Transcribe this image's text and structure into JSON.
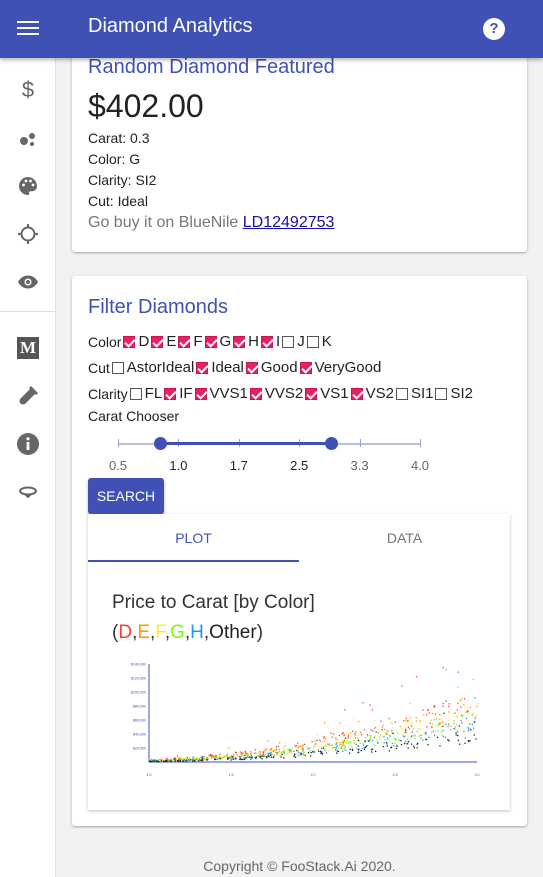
{
  "app": {
    "title": "Diamond Analytics"
  },
  "sidebar": {
    "items": [
      {
        "icon": "dollar-icon"
      },
      {
        "icon": "bubble-chart-icon"
      },
      {
        "icon": "palette-icon"
      },
      {
        "icon": "crosshair-icon"
      },
      {
        "icon": "eye-icon"
      },
      {
        "icon": "medium-icon",
        "glyph": "M"
      },
      {
        "icon": "test-tube-icon"
      },
      {
        "icon": "info-icon"
      },
      {
        "icon": "rotate-icon"
      }
    ]
  },
  "featured": {
    "title": "Random Diamond Featured",
    "price": "$402.00",
    "carat": "Carat: 0.3",
    "color": "Color: G",
    "clarity": "Clarity: SI2",
    "cut": "Cut: Ideal",
    "bluenile_text": "Go buy it on BlueNile",
    "bluenile_link": "LD12492753"
  },
  "filter": {
    "title": "Filter Diamonds",
    "color_label": "Color",
    "colors": [
      {
        "label": "D",
        "checked": true
      },
      {
        "label": "E",
        "checked": true
      },
      {
        "label": "F",
        "checked": true
      },
      {
        "label": "G",
        "checked": true
      },
      {
        "label": "H",
        "checked": true
      },
      {
        "label": "I",
        "checked": true
      },
      {
        "label": "J",
        "checked": false
      },
      {
        "label": "K",
        "checked": false
      }
    ],
    "cut_label": "Cut",
    "cuts": [
      {
        "label": "AstorIdeal",
        "checked": false
      },
      {
        "label": "Ideal",
        "checked": true
      },
      {
        "label": "Good",
        "checked": true
      },
      {
        "label": "VeryGood",
        "checked": true
      }
    ],
    "clarity_label": "Clarity",
    "clarities": [
      {
        "label": "FL",
        "checked": false
      },
      {
        "label": "IF",
        "checked": true
      },
      {
        "label": "VVS1",
        "checked": true
      },
      {
        "label": "VVS2",
        "checked": true
      },
      {
        "label": "VS1",
        "checked": true
      },
      {
        "label": "VS2",
        "checked": true
      },
      {
        "label": "SI1",
        "checked": false
      },
      {
        "label": "SI2",
        "checked": false
      }
    ],
    "carat_label": "Carat Chooser",
    "carat_ticks": [
      "0.5",
      "1.0",
      "1.7",
      "2.5",
      "3.3",
      "4.0"
    ],
    "carat_range": [
      1.0,
      3.0
    ],
    "search_label": "SEARCH"
  },
  "tabs": {
    "plot": "PLOT",
    "data": "DATA",
    "active": "PLOT"
  },
  "plot": {
    "title": "Price to Carat [by Color]",
    "legend": [
      {
        "label": "D",
        "color": "#f44336"
      },
      {
        "label": "E",
        "color": "#ff9800"
      },
      {
        "label": "F",
        "color": "#ffeb3b"
      },
      {
        "label": "G",
        "color": "#76ff03"
      },
      {
        "label": "H",
        "color": "#2196f3"
      },
      {
        "label": "Other",
        "color": "#222222"
      }
    ],
    "open_paren": "(",
    "close_paren": ")",
    "comma": ","
  },
  "chart_data": {
    "type": "scatter",
    "title": "Price to Carat [by Color]",
    "xlabel": "",
    "ylabel": "",
    "xlim": [
      1.0,
      3.0
    ],
    "ylim": [
      0,
      140000
    ],
    "x_ticks": [
      "1.0",
      "1.5",
      "2.0",
      "2.5",
      "3.0"
    ],
    "y_ticks": [
      "$20,000",
      "$40,000",
      "$60,000",
      "$80,000",
      "$100,000",
      "$120,000",
      "$140,000"
    ],
    "series": [
      {
        "name": "D",
        "color": "#f44336"
      },
      {
        "name": "E",
        "color": "#ff9800"
      },
      {
        "name": "F",
        "color": "#ffeb3b"
      },
      {
        "name": "G",
        "color": "#76ff03"
      },
      {
        "name": "H",
        "color": "#2196f3"
      },
      {
        "name": "Other",
        "color": "#222222"
      }
    ]
  },
  "footer": {
    "text": "Copyright © FooStack.Ai 2020."
  }
}
